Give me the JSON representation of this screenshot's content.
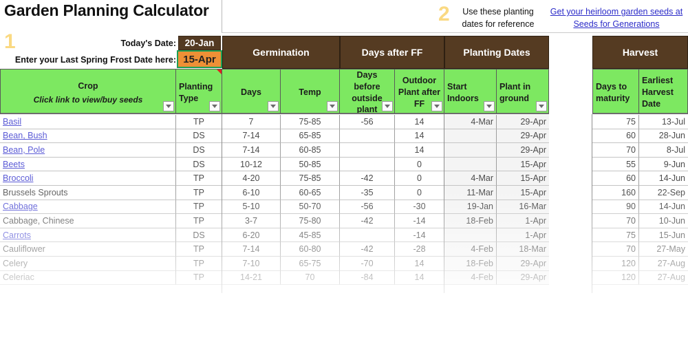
{
  "app": {
    "title": "Garden Planning Calculator"
  },
  "steps": {
    "one": "1",
    "two": "2"
  },
  "notes": {
    "reference": "Use these planting dates for reference",
    "seed_link": "Get your heirloom garden seeds at Seeds for Generations"
  },
  "inputs": {
    "today_label": "Today's Date:",
    "today_value": "20-Jan",
    "frost_label": "Enter your Last Spring Frost Date here:",
    "frost_value": "15-Apr"
  },
  "bands": [
    {
      "label": "Germination"
    },
    {
      "label": "Days after FF"
    },
    {
      "label": "Planting Dates"
    },
    {
      "label": "Harvest"
    }
  ],
  "columns": {
    "crop": {
      "label": "Crop",
      "sub": "Click link to view/buy seeds"
    },
    "planting_type": {
      "line1": "Planting",
      "line2": "Type"
    },
    "germ_days": {
      "label": "Days"
    },
    "germ_temp": {
      "label": "Temp"
    },
    "days_before_outside": {
      "line1": "Days before",
      "line2": "outside",
      "line3": "plant"
    },
    "outdoor_after_ff": {
      "line1": "Outdoor",
      "line2": "Plant after",
      "line3": "FF"
    },
    "start_indoors": {
      "line1": "Start",
      "line2": "Indoors"
    },
    "plant_in_ground": {
      "line1": "Plant in",
      "line2": "ground"
    },
    "days_to_maturity": {
      "line1": "Days to",
      "line2": "maturity"
    },
    "earliest_harvest": {
      "line1": "Earliest",
      "line2": "Harvest",
      "line3": "Date"
    }
  },
  "rows": [
    {
      "crop": "Basil",
      "link": true,
      "type": "TP",
      "days": "7",
      "temp": "75-85",
      "before": "-56",
      "after_ff": "14",
      "indoors": "4-Mar",
      "ground": "29-Apr",
      "maturity": "75",
      "harvest": "13-Jul"
    },
    {
      "crop": "Bean, Bush",
      "link": true,
      "type": "DS",
      "days": "7-14",
      "temp": "65-85",
      "before": "",
      "after_ff": "14",
      "indoors": "",
      "ground": "29-Apr",
      "maturity": "60",
      "harvest": "28-Jun"
    },
    {
      "crop": "Bean, Pole",
      "link": true,
      "type": "DS",
      "days": "7-14",
      "temp": "60-85",
      "before": "",
      "after_ff": "14",
      "indoors": "",
      "ground": "29-Apr",
      "maturity": "70",
      "harvest": "8-Jul"
    },
    {
      "crop": "Beets",
      "link": true,
      "type": "DS",
      "days": "10-12",
      "temp": "50-85",
      "before": "",
      "after_ff": "0",
      "indoors": "",
      "ground": "15-Apr",
      "maturity": "55",
      "harvest": "9-Jun"
    },
    {
      "crop": "Broccoli",
      "link": true,
      "type": "TP",
      "days": "4-20",
      "temp": "75-85",
      "before": "-42",
      "after_ff": "0",
      "indoors": "4-Mar",
      "ground": "15-Apr",
      "maturity": "60",
      "harvest": "14-Jun"
    },
    {
      "crop": "Brussels Sprouts",
      "link": false,
      "type": "TP",
      "days": "6-10",
      "temp": "60-65",
      "before": "-35",
      "after_ff": "0",
      "indoors": "11-Mar",
      "ground": "15-Apr",
      "maturity": "160",
      "harvest": "22-Sep"
    },
    {
      "crop": "Cabbage",
      "link": true,
      "type": "TP",
      "days": "5-10",
      "temp": "50-70",
      "before": "-56",
      "after_ff": "-30",
      "indoors": "19-Jan",
      "ground": "16-Mar",
      "maturity": "90",
      "harvest": "14-Jun"
    },
    {
      "crop": "Cabbage, Chinese",
      "link": false,
      "type": "TP",
      "days": "3-7",
      "temp": "75-80",
      "before": "-42",
      "after_ff": "-14",
      "indoors": "18-Feb",
      "ground": "1-Apr",
      "maturity": "70",
      "harvest": "10-Jun"
    },
    {
      "crop": "Carrots",
      "link": true,
      "type": "DS",
      "days": "6-20",
      "temp": "45-85",
      "before": "",
      "after_ff": "-14",
      "indoors": "",
      "ground": "1-Apr",
      "maturity": "75",
      "harvest": "15-Jun"
    },
    {
      "crop": "Cauliflower",
      "link": false,
      "type": "TP",
      "days": "7-14",
      "temp": "60-80",
      "before": "-42",
      "after_ff": "-28",
      "indoors": "4-Feb",
      "ground": "18-Mar",
      "maturity": "70",
      "harvest": "27-May"
    },
    {
      "crop": "Celery",
      "link": false,
      "type": "TP",
      "days": "7-10",
      "temp": "65-75",
      "before": "-70",
      "after_ff": "14",
      "indoors": "18-Feb",
      "ground": "29-Apr",
      "maturity": "120",
      "harvest": "27-Aug"
    },
    {
      "crop": "Celeriac",
      "link": false,
      "type": "TP",
      "days": "14-21",
      "temp": "70",
      "before": "-84",
      "after_ff": "14",
      "indoors": "4-Feb",
      "ground": "29-Apr",
      "maturity": "120",
      "harvest": "27-Aug"
    }
  ],
  "colors": {
    "band_brown": "#553B22",
    "header_green": "#7DE861",
    "frost_orange": "#EE9036",
    "link_blue": "#2b2bc8",
    "step_gold": "#fad982"
  }
}
